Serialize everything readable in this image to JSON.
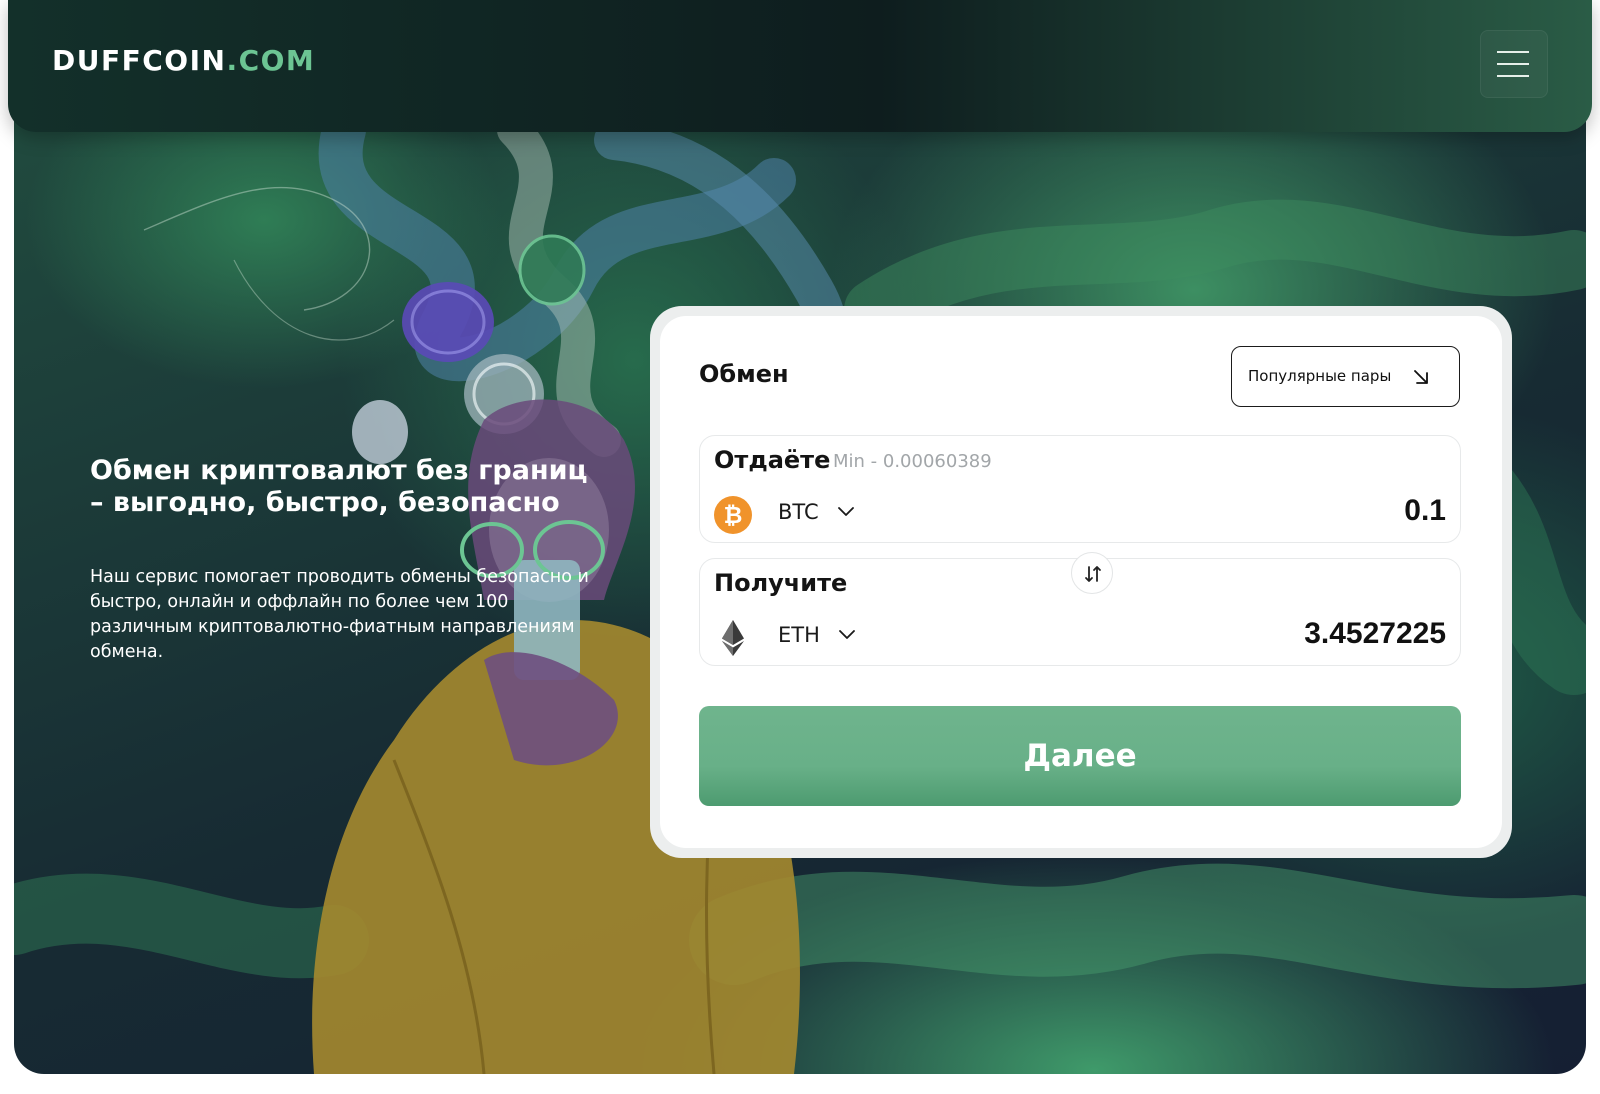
{
  "header": {
    "logo_main": "DUFFCOIN",
    "logo_accent": ".COM",
    "menu_icon": "hamburger-menu-icon"
  },
  "hero": {
    "title": "Обмен криптовалют без границ – выгодно, быстро, безопасно",
    "description": "Наш сервис помогает проводить обмены безопасно и быстро, онлайн и оффлайн по более чем 100 различным криптовалютно-фиатным направлениям обмена."
  },
  "exchange": {
    "title": "Обмен",
    "popular_pairs_label": "Популярные пары",
    "popular_pairs_icon": "arrow-down-right-icon",
    "send": {
      "label": "Отдаёте",
      "min_hint": "Min - 0.00060389",
      "coin": "BTC",
      "coin_icon": "bitcoin-icon",
      "amount": "0.1"
    },
    "swap_icon": "swap-arrows-icon",
    "receive": {
      "label": "Получите",
      "coin": "ETH",
      "coin_icon": "ethereum-icon",
      "amount": "3.4527225"
    },
    "next_label": "Далее"
  },
  "colors": {
    "accent_green": "#6cc593",
    "button_green": "#68b088",
    "bitcoin_orange": "#f0932b",
    "header_dark": "#0e1d1e"
  }
}
